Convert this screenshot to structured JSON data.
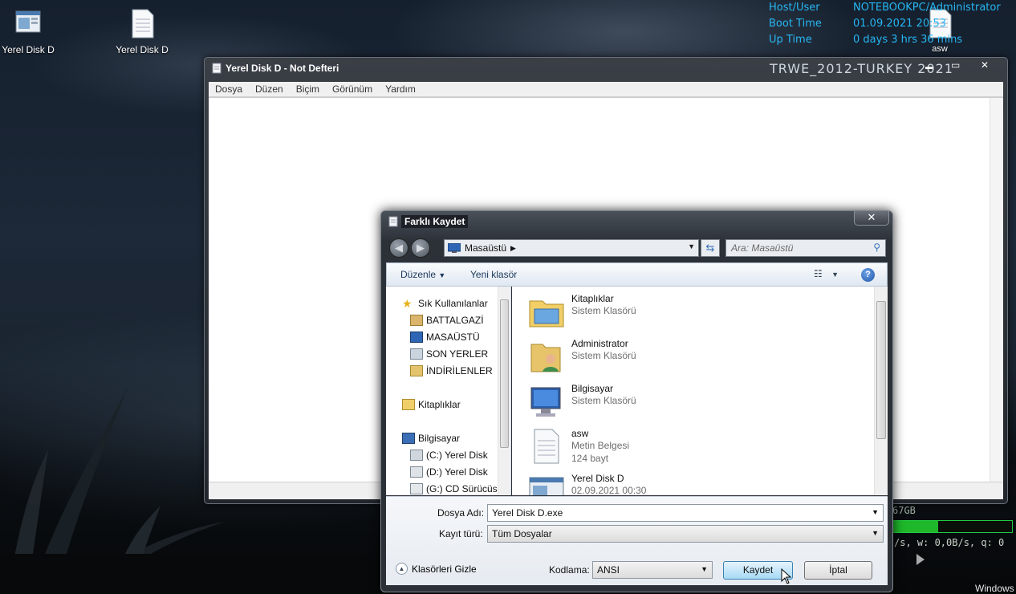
{
  "desktop": {
    "icons": [
      {
        "label": "Yerel Disk D",
        "icon": "exe-window-icon"
      },
      {
        "label": "Yerel Disk D",
        "icon": "text-document-icon"
      },
      {
        "label": "asw",
        "icon": "text-document-icon"
      }
    ],
    "conky": {
      "host_label": "Host/User",
      "host_value": "NOTEBOOKPC/Administrator",
      "boot_label": "Boot Time",
      "boot_value": "01.09.2021 20:53",
      "uptime_label": "Up Time",
      "uptime_value": "0 days 3 hrs 36 mins",
      "banner": "TRWE_2012-TURKEY 2021",
      "disk_text": "67GB",
      "io_text": "/s, w: 0,0B/s, q: 0",
      "windows_text": "Windows"
    }
  },
  "notepad": {
    "title": "Yerel Disk D - Not Defteri",
    "menu": [
      "Dosya",
      "Düzen",
      "Biçim",
      "Görünüm",
      "Yardım"
    ],
    "controls": {
      "minimize": "▬",
      "maximize": "▭",
      "close": "✕"
    }
  },
  "dialog": {
    "title": "Farklı Kaydet",
    "close": "✕",
    "address": "Masaüstü",
    "search_placeholder": "Ara: Masaüstü",
    "toolbar": {
      "organize": "Düzenle",
      "new_folder": "Yeni klasör"
    },
    "nav_tree": {
      "favorites": "Sık Kullanılanlar",
      "fav_items": [
        "BATTALGAZİ",
        "MASAÜSTÜ",
        "SON YERLER",
        "İNDİRİLENLER"
      ],
      "libraries": "Kitaplıklar",
      "computer": "Bilgisayar",
      "drives": [
        "(C:) Yerel Disk",
        "(D:) Yerel Disk",
        "(G:) CD Sürücüsü"
      ]
    },
    "files": [
      {
        "name": "Kitaplıklar",
        "detail1": "Sistem Klasörü",
        "detail2": ""
      },
      {
        "name": "Administrator",
        "detail1": "Sistem Klasörü",
        "detail2": ""
      },
      {
        "name": "Bilgisayar",
        "detail1": "Sistem Klasörü",
        "detail2": ""
      },
      {
        "name": "asw",
        "detail1": "Metin Belgesi",
        "detail2": "124 bayt"
      },
      {
        "name": "Yerel Disk D",
        "detail1": "02.09.2021 00:30",
        "detail2": ""
      }
    ],
    "filename_label": "Dosya Adı:",
    "filename_value": "Yerel Disk D.exe",
    "type_label": "Kayıt türü:",
    "type_value": "Tüm Dosyalar",
    "hide_folders": "Klasörleri Gizle",
    "encoding_label": "Kodlama:",
    "encoding_value": "ANSI",
    "save_button": "Kaydet",
    "cancel_button": "İptal"
  },
  "colors": {
    "conky_blue": "#27b6f2",
    "accent": "#3c7fb1"
  }
}
